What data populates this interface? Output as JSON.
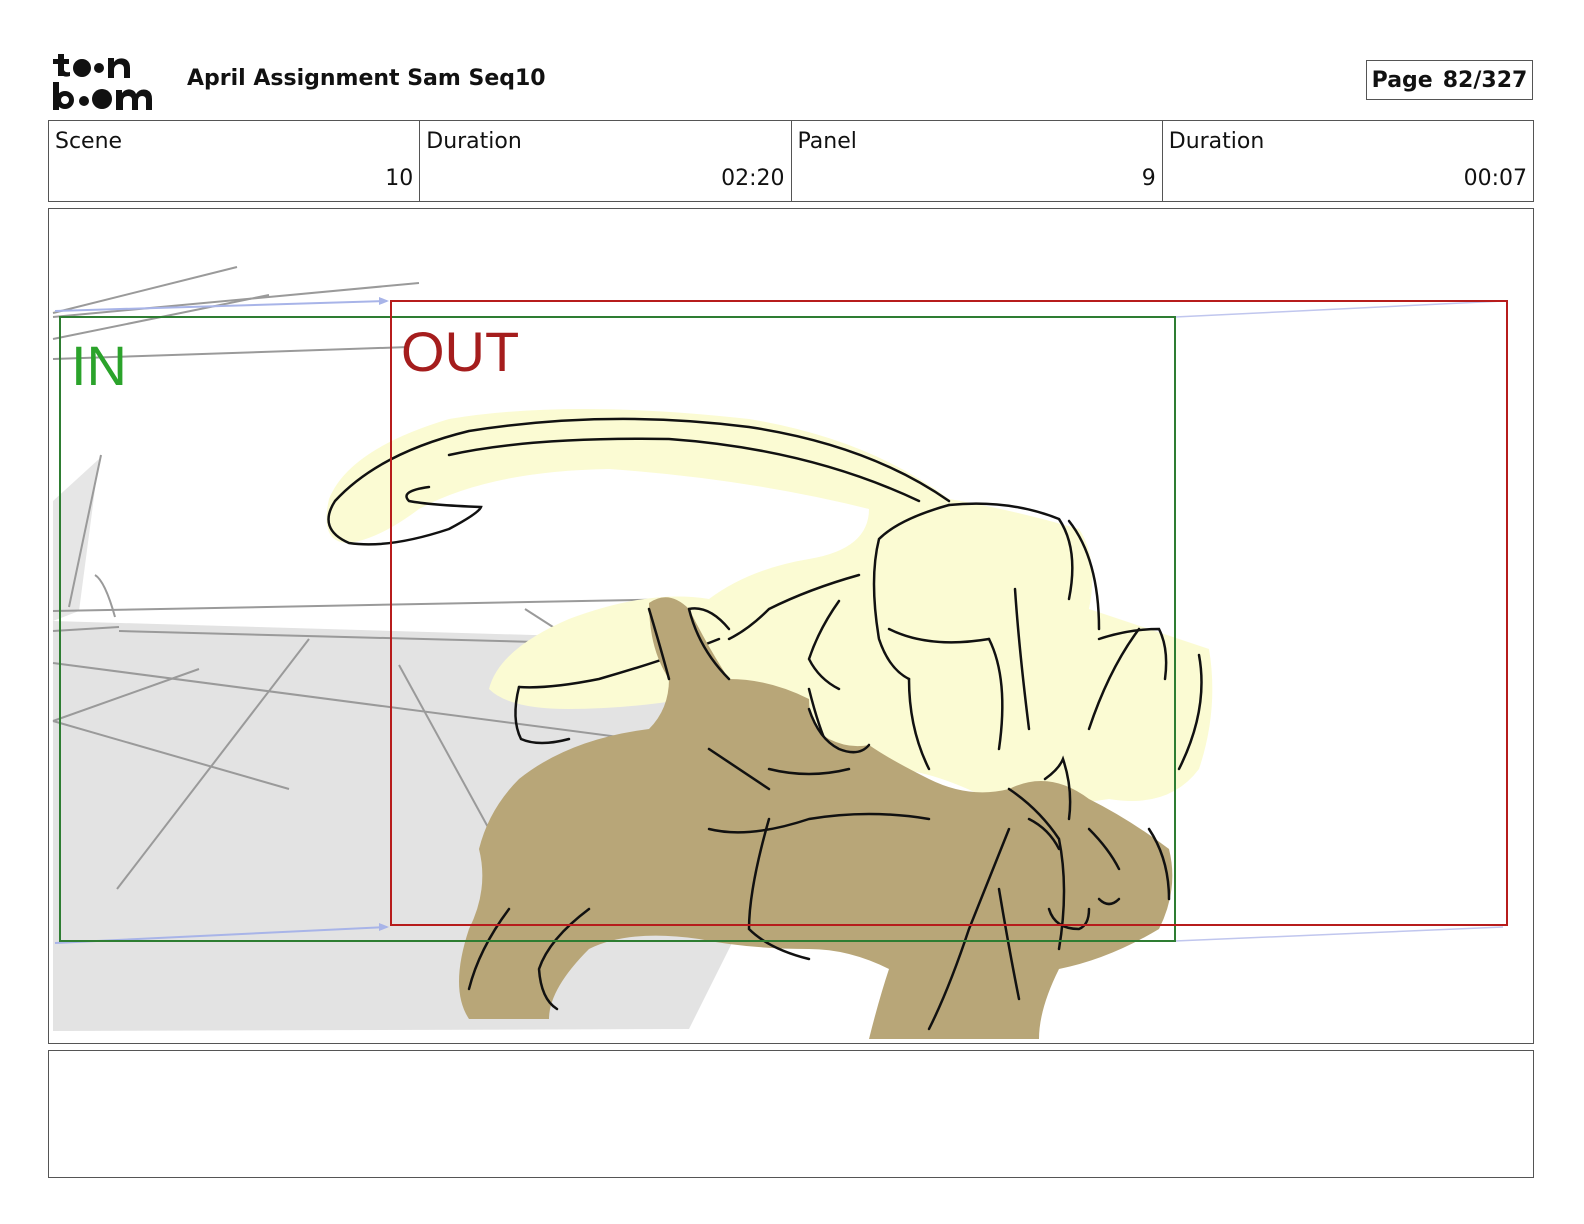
{
  "header": {
    "title": "April Assignment Sam Seq10",
    "page_label": "Page",
    "page_value": "82/327"
  },
  "info": {
    "scene_label": "Scene",
    "scene_value": "10",
    "scene_duration_label": "Duration",
    "scene_duration_value": "02:20",
    "panel_label": "Panel",
    "panel_value": "9",
    "panel_duration_label": "Duration",
    "panel_duration_value": "00:07"
  },
  "frames": {
    "in_label": "IN",
    "out_label": "OUT",
    "in_color": "#2e7d32",
    "out_color": "#b71c1c"
  },
  "notes": {
    "text": ""
  }
}
